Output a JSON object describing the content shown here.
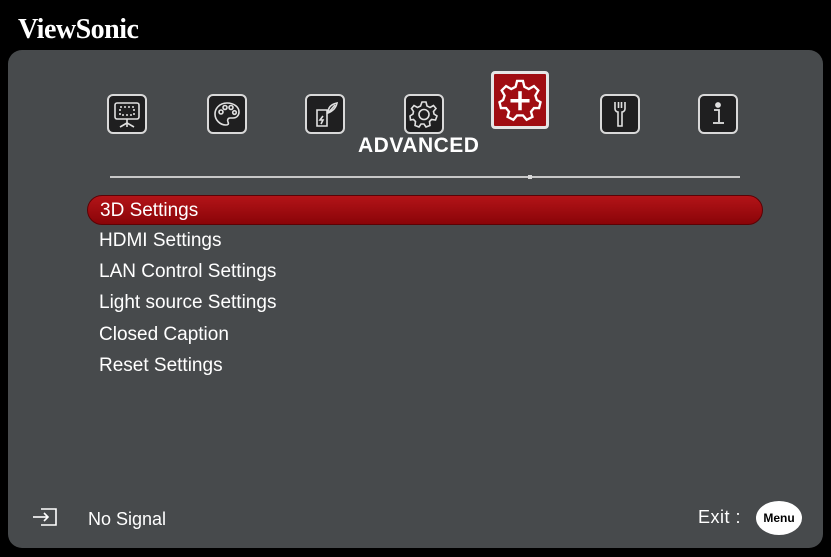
{
  "brand": "ViewSonic",
  "tabs": [
    {
      "icon": "display-icon",
      "active": false
    },
    {
      "icon": "palette-icon",
      "active": false
    },
    {
      "icon": "power-icon",
      "active": false
    },
    {
      "icon": "gear-icon",
      "active": false
    },
    {
      "icon": "advanced-gear-icon",
      "active": true
    },
    {
      "icon": "wrench-icon",
      "active": false
    },
    {
      "icon": "info-icon",
      "active": false
    }
  ],
  "section_title": "ADVANCED",
  "menu": {
    "items": [
      {
        "label": "3D Settings",
        "selected": true
      },
      {
        "label": "HDMI Settings",
        "selected": false
      },
      {
        "label": "LAN Control Settings",
        "selected": false
      },
      {
        "label": "Light source Settings",
        "selected": false
      },
      {
        "label": "Closed Caption",
        "selected": false
      },
      {
        "label": "Reset Settings",
        "selected": false
      }
    ]
  },
  "footer": {
    "signal_icon": "input-source-icon",
    "signal_status": "No Signal",
    "exit_label": "Exit :",
    "menu_button": "Menu"
  },
  "colors": {
    "panel": "#474a4c",
    "selection": "#a00d12",
    "text": "#ffffff"
  }
}
